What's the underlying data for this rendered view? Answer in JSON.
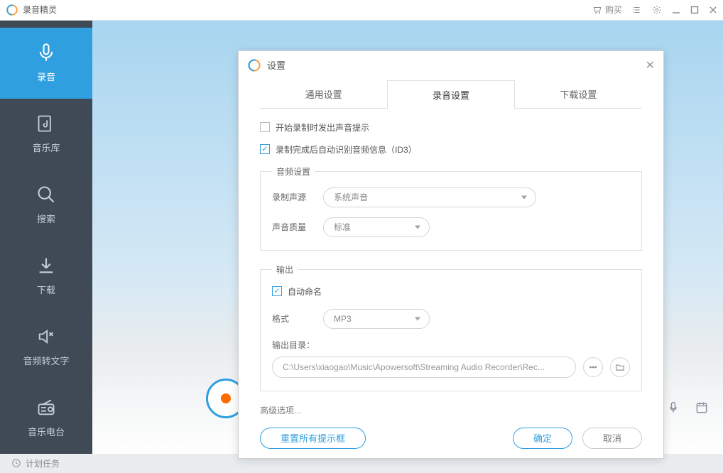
{
  "app": {
    "title": "录音精灵"
  },
  "titlebar": {
    "buy": "购买"
  },
  "sidebar": {
    "record": "录音",
    "library": "音乐库",
    "search": "搜索",
    "download": "下载",
    "audio_to_text": "音频转文字",
    "radio": "音乐电台"
  },
  "footer": {
    "tasks": "计划任务"
  },
  "dialog": {
    "title": "设置",
    "tabs": [
      "通用设置",
      "录音设置",
      "下载设置"
    ],
    "chk_sound_hint": "开始录制时发出声音提示",
    "chk_auto_id3": "录制完成后自动识别音频信息（ID3）",
    "group_audio": "音频设置",
    "field_source": "录制声源",
    "value_source": "系统声音",
    "field_quality": "声音质量",
    "value_quality": "标准",
    "group_output": "输出",
    "chk_auto_name": "自动命名",
    "field_format": "格式",
    "value_format": "MP3",
    "field_out_dir": "输出目录：",
    "value_out_dir": "C:\\Users\\xiaogao\\Music\\Apowersoft\\Streaming Audio Recorder\\Rec...",
    "advanced": "高级选项...",
    "reset": "重置所有提示框",
    "ok": "确定",
    "cancel": "取消"
  }
}
